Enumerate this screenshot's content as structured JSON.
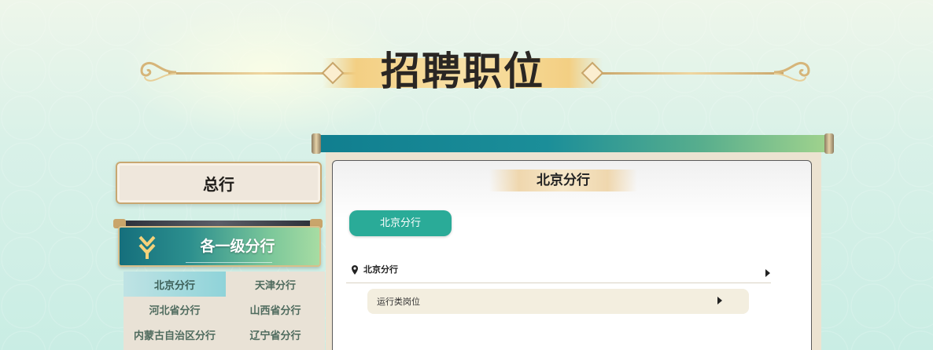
{
  "page_title": "招聘职位",
  "sidebar": {
    "headquarters_label": "总行",
    "branches_header": "各一级分行",
    "branches": [
      {
        "label": "北京分行",
        "active": true
      },
      {
        "label": "天津分行",
        "active": false
      },
      {
        "label": "河北省分行",
        "active": false
      },
      {
        "label": "山西省分行",
        "active": false
      },
      {
        "label": "内蒙古自治区分行",
        "active": false
      },
      {
        "label": "辽宁省分行",
        "active": false
      }
    ]
  },
  "main": {
    "panel_title": "北京分行",
    "branch_tab_label": "北京分行",
    "location_label": "北京分行",
    "job_category": "运行类岗位"
  },
  "colors": {
    "accent_teal": "#2aab98",
    "header_teal": "#156f7c",
    "gold": "#c8a771"
  },
  "icons": {
    "location": "location-pin-icon",
    "expand": "caret-right-icon",
    "branch_indicator": "double-chevron-down-icon"
  }
}
